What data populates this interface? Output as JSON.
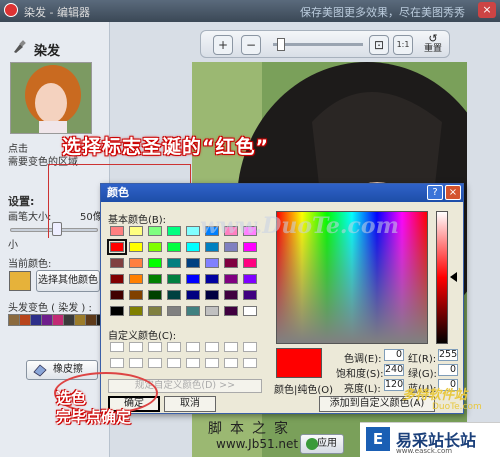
{
  "titlebar": {
    "app_title": "染发 - 编辑器",
    "hint": "保存美图更多效果，尽在美图秀秀"
  },
  "left_panel": {
    "section_title": "染发",
    "desc_line1": "点击",
    "desc_line2": "需要变色的区域",
    "settings_label": "设置:",
    "brush_size_label": "画笔大小:",
    "brush_size_value": "50像",
    "brush_small_label": "小",
    "current_color_label": "当前颜色:",
    "current_color": "#e6b23a",
    "pick_other_color_button": "选择其他颜色",
    "hair_colors_label": "头发变色 ( 染发 ) :",
    "hair_swatches": [
      "#8b6a3e",
      "#b8451c",
      "#2d2f8a",
      "#6f1e8c",
      "#c22a74",
      "#3a3a3a",
      "#9c7c2a",
      "#5e3a1a",
      "#1a1a1a"
    ],
    "eraser_button": "橡皮擦"
  },
  "toolbar": {
    "zoom_in": "+",
    "zoom_out": "−",
    "fit": "⊡",
    "actual": "1:1",
    "reset_label": "重置"
  },
  "instruction": "选择标志圣诞的“红色”",
  "dialog": {
    "title": "颜色",
    "help": "?",
    "close": "×",
    "basic_colors_label": "基本颜色(B):",
    "basic_colors": [
      "#ff8080",
      "#ffff80",
      "#80ff80",
      "#00ff80",
      "#80ffff",
      "#0080ff",
      "#ff80c0",
      "#ff80ff",
      "#ff0000",
      "#ffff00",
      "#80ff00",
      "#00ff40",
      "#00ffff",
      "#0080c0",
      "#8080c0",
      "#ff00ff",
      "#804040",
      "#ff8040",
      "#00ff00",
      "#008080",
      "#004080",
      "#8080ff",
      "#800040",
      "#ff0080",
      "#800000",
      "#ff8000",
      "#008000",
      "#008040",
      "#0000ff",
      "#0000a0",
      "#800080",
      "#8000ff",
      "#400000",
      "#804000",
      "#004000",
      "#004040",
      "#000080",
      "#000040",
      "#400040",
      "#400080",
      "#000000",
      "#808000",
      "#808040",
      "#808080",
      "#408080",
      "#c0c0c0",
      "#400040",
      "#ffffff"
    ],
    "selected_color_index": 8,
    "custom_colors_label": "自定义颜色(C):",
    "define_custom_button": "规定自定义颜色(D) >>",
    "ok_button": "确定",
    "cancel_button": "取消",
    "preview_color": "#ff0000",
    "preview_label": "颜色|纯色(O)",
    "hue_label": "色调(E):",
    "hue_value": "0",
    "sat_label": "饱和度(S):",
    "sat_value": "240",
    "lum_label": "亮度(L):",
    "lum_value": "120",
    "red_label": "红(R):",
    "red_value": "255",
    "green_label": "绿(G):",
    "green_value": "0",
    "blue_label": "蓝(U):",
    "blue_value": "0",
    "add_custom_button": "添加到自定义颜色(A)"
  },
  "annotations": {
    "line1": "选色",
    "line2": "完毕点确定"
  },
  "watermarks": {
    "duote": "www.DuoTe.com",
    "jb51_top": "脚本之家",
    "jb51_url": "www.Jb51.net",
    "duote_corner": "多特软件站",
    "duote_corner_url": "DuoTe.com"
  },
  "apply_button": "应用",
  "brand": {
    "name": "易采站长站",
    "url": "www.easck.com"
  }
}
